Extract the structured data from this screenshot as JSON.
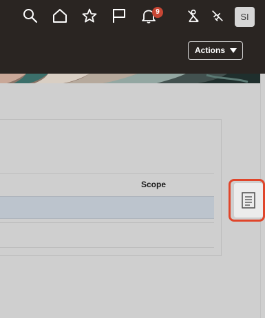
{
  "header": {
    "icons": [
      "search-icon",
      "home-icon",
      "favorites-star-icon",
      "flag-icon",
      "notifications-bell-icon",
      "pinned-accessibility-icon",
      "disconnected-icon"
    ],
    "notification_count": "9",
    "user_initials": "SI"
  },
  "subheader": {
    "actions_label": "Actions"
  },
  "table": {
    "columns": [
      "Scope"
    ]
  },
  "side_panel": {
    "icon": "document-list-icon"
  },
  "colors": {
    "topbar": "#2a2522",
    "badge": "#c74634",
    "selected_row": "#bcc4cd",
    "highlight_ring": "#e0452a"
  }
}
